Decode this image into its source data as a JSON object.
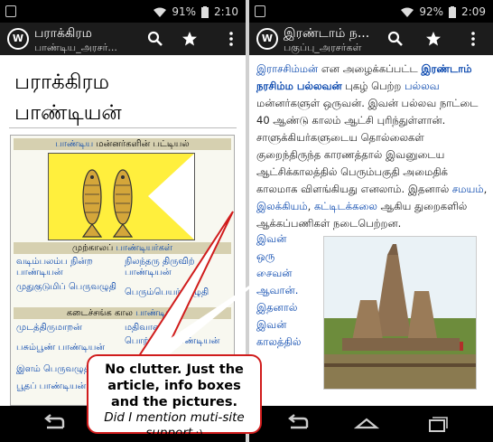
{
  "left": {
    "status": {
      "battery": "91%",
      "time": "2:10"
    },
    "actionbar": {
      "app_icon": "W",
      "title": "பராக்கிரம",
      "subtitle": "பாண்டிய_அரசர்..."
    },
    "article_title_line1": "பராக்கிரம",
    "article_title_line2": "பாண்டியன்",
    "infobox": {
      "header_link": "பாண்டிய",
      "header_text": " மன்னர்களின் பட்டியல்",
      "section1_text": "முற்காலப் ",
      "section1_link": "பாண்டியர்கள்",
      "items1_left": [
        "வடிம்பலம்ப நின்ற பாண்டியன்",
        "முதுகுடுமிப் பெருவழுதி"
      ],
      "items1_right": [
        "நிலந்தரு திருவிற் பாண்டியன்",
        "பெரும்பெயர் வழுதி"
      ],
      "section2_text": "கடைச்சங்க கால ",
      "section2_link": "பாண்டியர்",
      "items2_left": [
        "முடத்திருமாறன்",
        "பசும்பூண் பாண்டியன்",
        "இளம் பெருவழுதி",
        "பூதப் பாண்டியன்"
      ],
      "items2_right": [
        "மதிவாணன்",
        "பொற்கைப் பாண்டியன்",
        "",
        ""
      ]
    },
    "flag_icon": "twin-fish-flag"
  },
  "right": {
    "status": {
      "battery": "92%",
      "time": "2:09"
    },
    "actionbar": {
      "app_icon": "W",
      "title": "இரண்டாம் ந...",
      "subtitle": "பகுப்பு_அரசர்கள்"
    },
    "paragraph": [
      {
        "t": "இராசசிம்மன்",
        "c": "link"
      },
      {
        "t": " என அழைக்கப்பட்ட ",
        "c": ""
      },
      {
        "t": "இரண்டாம் நரசிம்ம பல்லவன்",
        "c": "linkb"
      },
      {
        "t": " புகழ் பெற்ற ",
        "c": ""
      },
      {
        "t": "பல்லவ",
        "c": "link"
      },
      {
        "t": " மன்னர்களுள் ஒருவன். இவன் பல்லவ நாட்டை 40 ஆண்டு காலம் ஆட்சி புரிந்துள்ளான். சாளுக்கியர்களுடைய தொல்லைகள் குறைந்திருந்த காரணத்தால் இவனுடைய ஆட்சிக்காலத்தில் பெரும்பகுதி அமைதிக் காலமாக விளங்கியது எனலாம். இதனால் ",
        "c": ""
      },
      {
        "t": "சமயம்",
        "c": "link"
      },
      {
        "t": ", ",
        "c": ""
      },
      {
        "t": "இலக்கியம்",
        "c": "link"
      },
      {
        "t": ", ",
        "c": ""
      },
      {
        "t": "கட்டிடக்கலை",
        "c": "link"
      },
      {
        "t": " ஆகிய துறைகளில் ஆக்கப்பணிகள் நடைபெற்றன.",
        "c": ""
      }
    ],
    "column_words": [
      "இவன்",
      "ஒரு",
      "சைவன்",
      "ஆவான்.",
      "இதனால்",
      "இவன்",
      "காலத்தில்"
    ],
    "photo_icon": "shore-temple-photo"
  },
  "callout": {
    "main": "No clutter. Just the article, info boxes and the pictures.",
    "extra": "Did  I mention muti-site support",
    "tail": " :)",
    "color": "#d01c1c"
  },
  "colors": {
    "link": "#0645ad",
    "bar": "#1c1c1c",
    "infobox_head": "#d6d0b0",
    "flag": "#ffef3d"
  }
}
